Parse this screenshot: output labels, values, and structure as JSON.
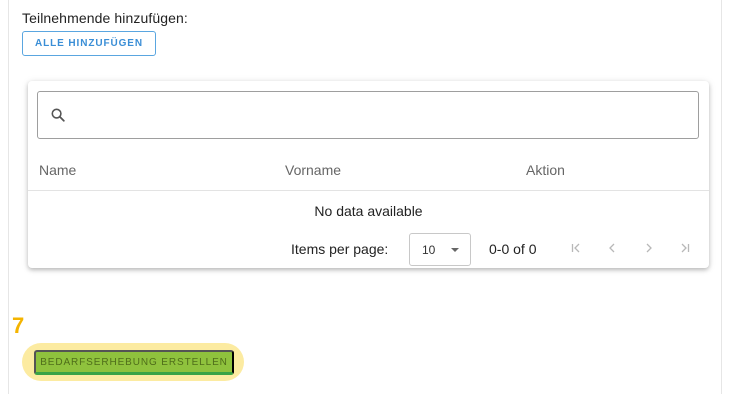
{
  "participants": {
    "section_label": "Teilnehmende hinzufügen:",
    "add_all_button_label": "ALLE HINZUFÜGEN"
  },
  "table": {
    "search": {
      "value": "",
      "placeholder": "",
      "icon": "search-icon"
    },
    "columns": [
      "Name",
      "Vorname",
      "Aktion"
    ],
    "empty_text": "No data available",
    "pagination": {
      "items_per_page_label": "Items per page:",
      "items_per_page_value": "10",
      "range_text": "0-0 of 0",
      "first_icon": "first-page-icon",
      "prev_icon": "chevron-left-icon",
      "next_icon": "chevron-right-icon",
      "last_icon": "last-page-icon"
    }
  },
  "annotation": {
    "step_number": "7",
    "highlight_color": "#f5d65b"
  },
  "create_button": {
    "label": "BEDARFSERHEBUNG ERSTELLEN",
    "color": "#8fc23d"
  }
}
